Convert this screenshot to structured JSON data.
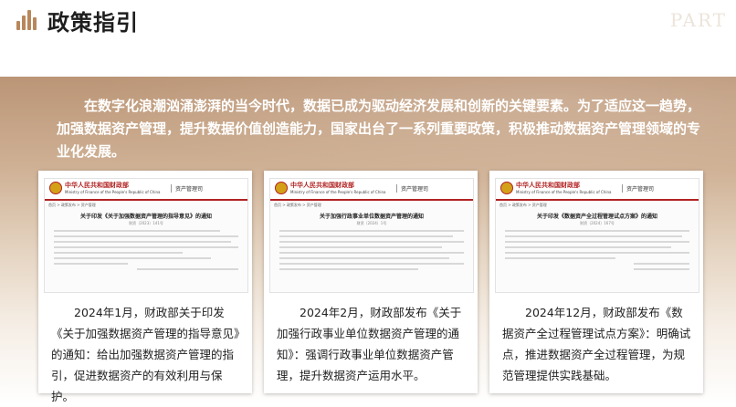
{
  "header": {
    "title": "政策指引",
    "watermark": "PART"
  },
  "intro": "在数字化浪潮汹涌澎湃的当今时代，数据已成为驱动经济发展和创新的关键要素。为了适应这一趋势，加强数据资产管理，提升数据价值创造能力，国家出台了一系列重要政策，积极推动数据资产管理领域的专业化发展。",
  "colors": {
    "accent": "#b8875b",
    "ministry_red": "#b22222"
  },
  "cards": [
    {
      "ministry": "中华人民共和国财政部",
      "ministry_en": "Ministry of Finance of the People's Republic of China",
      "dept": "资产管理司",
      "nav": "首页 > 政策发布 > 资产管理",
      "doc_title": "关于印发《关于加强数据资产管理的指导意见》的通知",
      "doc_meta": "财资〔2023〕141号",
      "caption": "2024年1月，财政部关于印发《关于加强数据资产管理的指导意见》的通知：给出加强数据资产管理的指引，促进数据资产的有效利用与保护。"
    },
    {
      "ministry": "中华人民共和国财政部",
      "ministry_en": "Ministry of Finance of the People's Republic of China",
      "dept": "资产管理司",
      "nav": "首页 > 政策发布 > 资产管理",
      "doc_title": "关于加强行政事业单位数据资产管理的通知",
      "doc_meta": "财资〔2024〕1号",
      "caption": "2024年2月，财政部发布《关于加强行政事业单位数据资产管理的通知》：强调行政事业单位数据资产管理，提升数据资产运用水平。"
    },
    {
      "ministry": "中华人民共和国财政部",
      "ministry_en": "Ministry of Finance of the People's Republic of China",
      "dept": "资产管理司",
      "nav": "首页 > 政策发布 > 资产管理",
      "doc_title": "关于印发《数据资产全过程管理试点方案》的通知",
      "doc_meta": "财资〔2024〕167号",
      "caption": "2024年12月，财政部发布《数据资产全过程管理试点方案》：明确试点，推进数据资产全过程管理，为规范管理提供实践基础。"
    }
  ]
}
